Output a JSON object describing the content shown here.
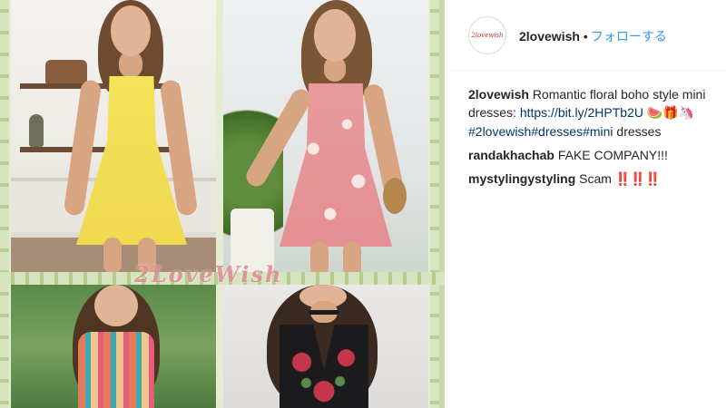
{
  "collage": {
    "watermark": "2LoveWish"
  },
  "header": {
    "avatar_text": "2lovewish",
    "username": "2lovewish",
    "separator": "•",
    "follow_label": "フォローする"
  },
  "caption": {
    "username": "2lovewish",
    "text": "Romantic floral boho style mini dresses: ",
    "link": "https://bit.ly/2HPTb2U",
    "emojis": [
      "🍉",
      "🎁",
      "🦄"
    ],
    "hashtags": [
      "#2lovewish",
      "#dresses",
      "#mini"
    ],
    "after_tags": " dresses"
  },
  "comments": [
    {
      "username": "randakhachab",
      "text": "FAKE COMPANY!!!"
    },
    {
      "username": "mystylingystyling",
      "text": "Scam",
      "suffix": "‼️‼️‼️"
    }
  ],
  "colors": {
    "follow": "#3897f0",
    "link": "#003569",
    "text": "#262626"
  }
}
